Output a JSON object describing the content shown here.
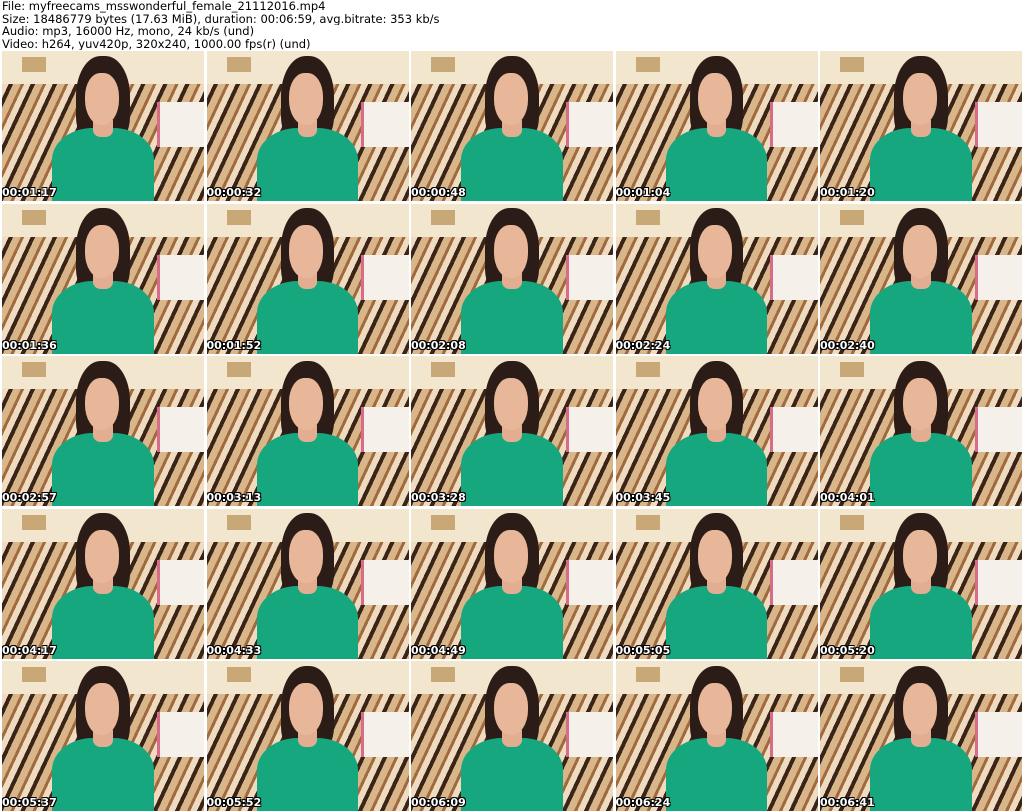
{
  "header": {
    "file_line": "File: myfreecams_msswonderful_female_21112016.mp4",
    "size_line": "Size: 18486779 bytes (17.63 MiB), duration: 00:06:59, avg.bitrate: 353 kb/s",
    "audio_line": "Audio: mp3, 16000 Hz, mono, 24 kb/s (und)",
    "video_line": "Video: h264, yuv420p, 320x240, 1000.00 fps(r) (und)"
  },
  "colors": {
    "background": "#ffffff",
    "dress": "#17a77f",
    "hair": "#2b1c17",
    "timestamp_text": "#ffffff",
    "timestamp_outline": "#000000"
  },
  "thumbnails": [
    {
      "timestamp": "00:01:17"
    },
    {
      "timestamp": "00:00:32"
    },
    {
      "timestamp": "00:00:48"
    },
    {
      "timestamp": "00:01:04"
    },
    {
      "timestamp": "00:01:20"
    },
    {
      "timestamp": "00:01:36"
    },
    {
      "timestamp": "00:01:52"
    },
    {
      "timestamp": "00:02:08"
    },
    {
      "timestamp": "00:02:24"
    },
    {
      "timestamp": "00:02:40"
    },
    {
      "timestamp": "00:02:57"
    },
    {
      "timestamp": "00:03:13"
    },
    {
      "timestamp": "00:03:28"
    },
    {
      "timestamp": "00:03:45"
    },
    {
      "timestamp": "00:04:01"
    },
    {
      "timestamp": "00:04:17"
    },
    {
      "timestamp": "00:04:33"
    },
    {
      "timestamp": "00:04:49"
    },
    {
      "timestamp": "00:05:05"
    },
    {
      "timestamp": "00:05:20"
    },
    {
      "timestamp": "00:05:37"
    },
    {
      "timestamp": "00:05:52"
    },
    {
      "timestamp": "00:06:09"
    },
    {
      "timestamp": "00:06:24"
    },
    {
      "timestamp": "00:06:41"
    }
  ]
}
